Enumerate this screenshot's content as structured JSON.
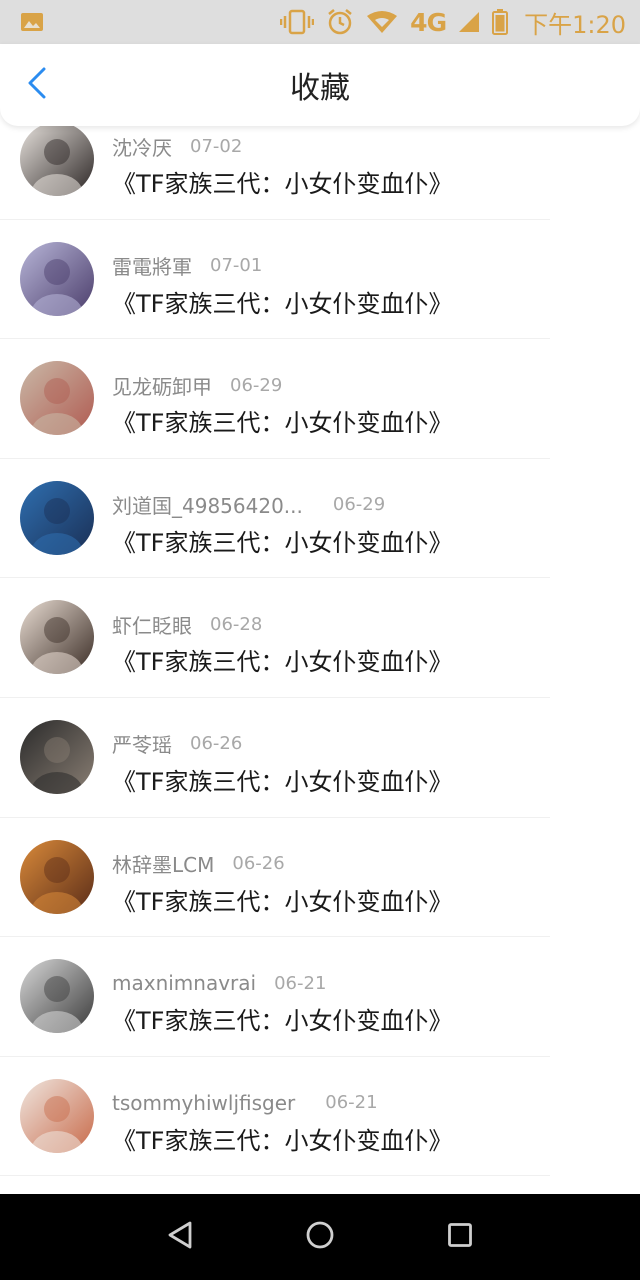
{
  "status_bar": {
    "network": "4G",
    "time": "下午1:20",
    "icons": [
      "image-icon",
      "vibrate-icon",
      "alarm-icon",
      "wifi-icon",
      "signal-icon",
      "battery-icon"
    ],
    "icon_color": "#d9a347"
  },
  "header": {
    "title": "收藏",
    "back_icon": "chevron-left-icon",
    "accent_color": "#2b8cf0"
  },
  "items": [
    {
      "author": "沈冷厌",
      "date": "07-02",
      "title": "《TF家族三代：小女仆变血仆》",
      "avatar_colors": [
        "#e9e4df",
        "#2a2423"
      ]
    },
    {
      "author": "雷電將軍",
      "date": "07-01",
      "title": "《TF家族三代：小女仆变血仆》",
      "avatar_colors": [
        "#b8b6d8",
        "#4a3c6a"
      ]
    },
    {
      "author": "见龙砺卸甲",
      "date": "06-29",
      "title": "《TF家族三代：小女仆变血仆》",
      "avatar_colors": [
        "#c9b9a8",
        "#b05a50"
      ]
    },
    {
      "author": "刘道国_49856420...",
      "date": "06-29",
      "title": "《TF家族三代：小女仆变血仆》",
      "avatar_colors": [
        "#2f6fb0",
        "#1a2f55"
      ]
    },
    {
      "author": "虾仁眨眼",
      "date": "06-28",
      "title": "《TF家族三代：小女仆变血仆》",
      "avatar_colors": [
        "#e9ddd3",
        "#3a2c25"
      ]
    },
    {
      "author": "严苓瑶",
      "date": "06-26",
      "title": "《TF家族三代：小女仆变血仆》",
      "avatar_colors": [
        "#2a2a2a",
        "#8a7f74"
      ]
    },
    {
      "author": "林辞墨LCM",
      "date": "06-26",
      "title": "《TF家族三代：小女仆变血仆》",
      "avatar_colors": [
        "#d98a3a",
        "#5a2c18"
      ]
    },
    {
      "author": "maxnimnavrai",
      "date": "06-21",
      "title": "《TF家族三代：小女仆变血仆》",
      "avatar_colors": [
        "#d8d8d8",
        "#3a3a3a"
      ]
    },
    {
      "author": "tsommyhiwljfisger",
      "date": "06-21",
      "title": "《TF家族三代：小女仆变血仆》",
      "avatar_colors": [
        "#efe6df",
        "#c86a4a"
      ]
    }
  ],
  "nav_bar": {
    "buttons": [
      "back-triangle-icon",
      "home-circle-icon",
      "recents-square-icon"
    ]
  }
}
